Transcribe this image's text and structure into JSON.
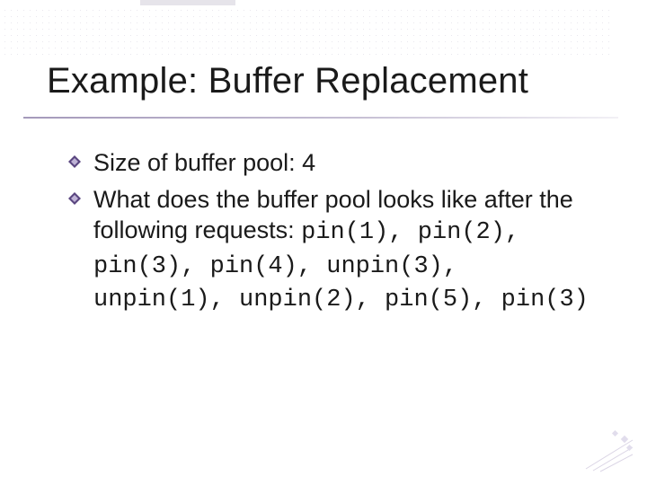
{
  "title": "Example: Buffer Replacement",
  "bullets": [
    {
      "text": "Size of buffer pool: 4"
    },
    {
      "prefix": "What does the buffer pool looks like after the following requests: ",
      "code": "pin(1), pin(2), pin(3), pin(4), unpin(3), unpin(1), unpin(2), pin(5), pin(3)"
    }
  ]
}
